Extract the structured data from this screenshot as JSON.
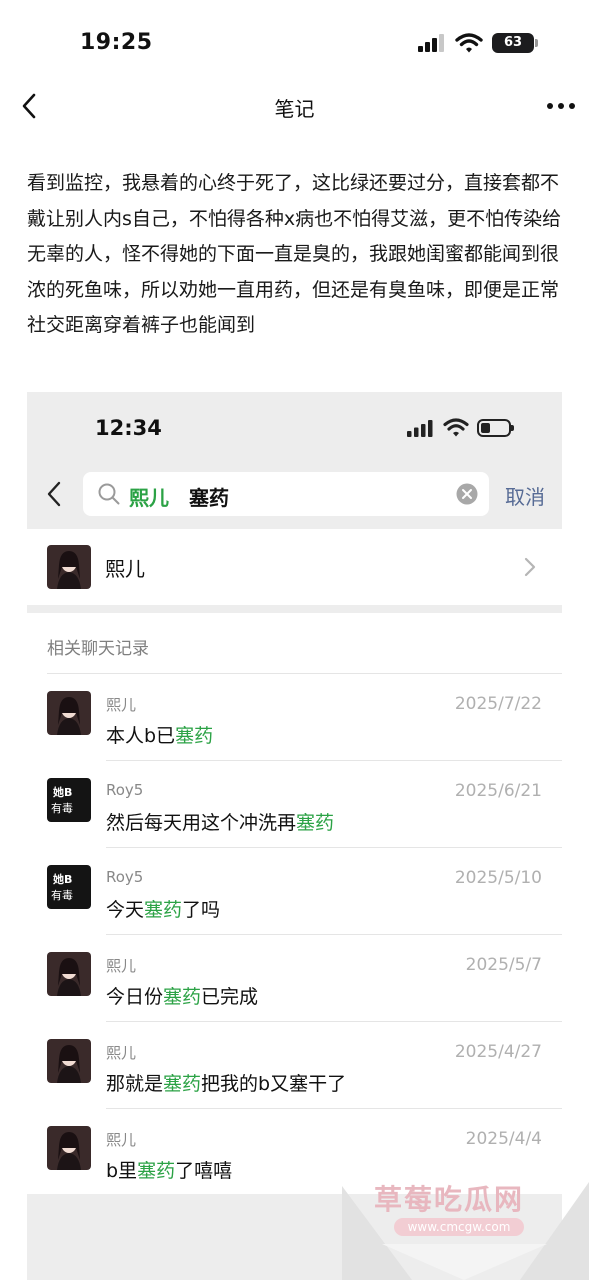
{
  "status_bar": {
    "time": "19:25",
    "battery": "63"
  },
  "nav": {
    "title": "笔记"
  },
  "article": {
    "text": "看到监控，我悬着的心终于死了，这比绿还要过分，直接套都不戴让别人内s自己，不怕得各种x病也不怕得艾滋，更不怕传染给无辜的人，怪不得她的下面一直是臭的，我跟她闺蜜都能闻到很浓的死鱼味，所以劝她一直用药，但还是有臭鱼味，即便是正常社交距离穿着裤子也能闻到"
  },
  "screenshot": {
    "status_time": "12:34",
    "search": {
      "term_name": "熙儿",
      "term_keyword": "塞药"
    },
    "cancel_label": "取消",
    "contact": {
      "name": "熙儿"
    },
    "section_title": "相关聊天记录",
    "results": [
      {
        "sender": "熙儿",
        "date": "2025/7/22",
        "pre": "本人b已",
        "hl": "塞药",
        "post": "",
        "avatar": "girl"
      },
      {
        "sender": "Roy5",
        "date": "2025/6/21",
        "pre": "然后每天用这个冲洗再",
        "hl": "塞药",
        "post": "",
        "avatar": "black"
      },
      {
        "sender": "Roy5",
        "date": "2025/5/10",
        "pre": "今天",
        "hl": "塞药",
        "post": "了吗",
        "avatar": "black"
      },
      {
        "sender": "熙儿",
        "date": "2025/5/7",
        "pre": "今日份",
        "hl": "塞药",
        "post": "已完成",
        "avatar": "girl"
      },
      {
        "sender": "熙儿",
        "date": "2025/4/27",
        "pre": "那就是",
        "hl": "塞药",
        "post": "把我的b又塞干了",
        "avatar": "girl"
      },
      {
        "sender": "熙儿",
        "date": "2025/4/4",
        "pre": "b里",
        "hl": "塞药",
        "post": "了嘻嘻",
        "avatar": "girl"
      }
    ],
    "black_avatar_text": {
      "line1": "她B",
      "line2": "有毒"
    }
  },
  "watermark": {
    "title": "草莓吃瓜网",
    "url": "www.cmcgw.com"
  },
  "colors": {
    "accent_green": "#2ba245",
    "link_blue": "#576b95",
    "gray_bg": "#ededed"
  }
}
